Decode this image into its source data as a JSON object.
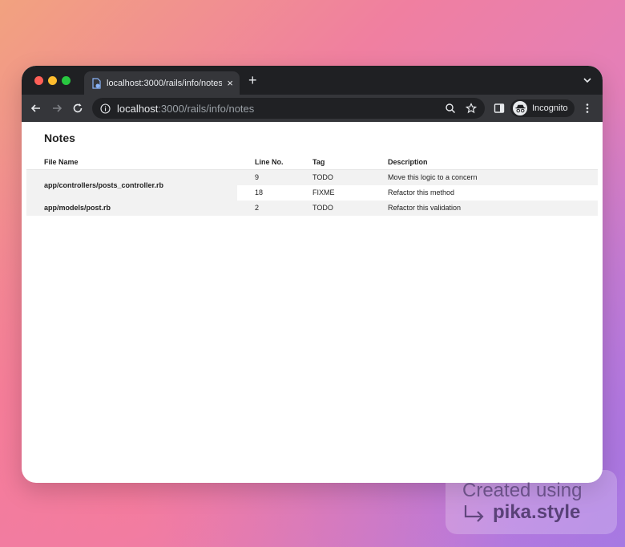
{
  "browser": {
    "tab_title": "localhost:3000/rails/info/notes",
    "tab_close": "×",
    "new_tab": "+",
    "url_host": "localhost",
    "url_path": ":3000/rails/info/notes",
    "incognito_label": "Incognito"
  },
  "page": {
    "title": "Notes",
    "columns": [
      "File Name",
      "Line No.",
      "Tag",
      "Description"
    ],
    "notes": [
      {
        "file": "app/controllers/posts_controller.rb",
        "entries": [
          {
            "line": "9",
            "tag": "TODO",
            "description": "Move this logic to a concern"
          },
          {
            "line": "18",
            "tag": "FIXME",
            "description": "Refactor this method"
          }
        ]
      },
      {
        "file": "app/models/post.rb",
        "entries": [
          {
            "line": "2",
            "tag": "TODO",
            "description": "Refactor this validation"
          }
        ]
      }
    ]
  },
  "watermark": {
    "line1": "Created using",
    "line2": "pika.style"
  },
  "colors": {
    "chrome_dark": "#1f2023",
    "toolbar": "#35363a",
    "row_shade": "#f2f2f2"
  }
}
